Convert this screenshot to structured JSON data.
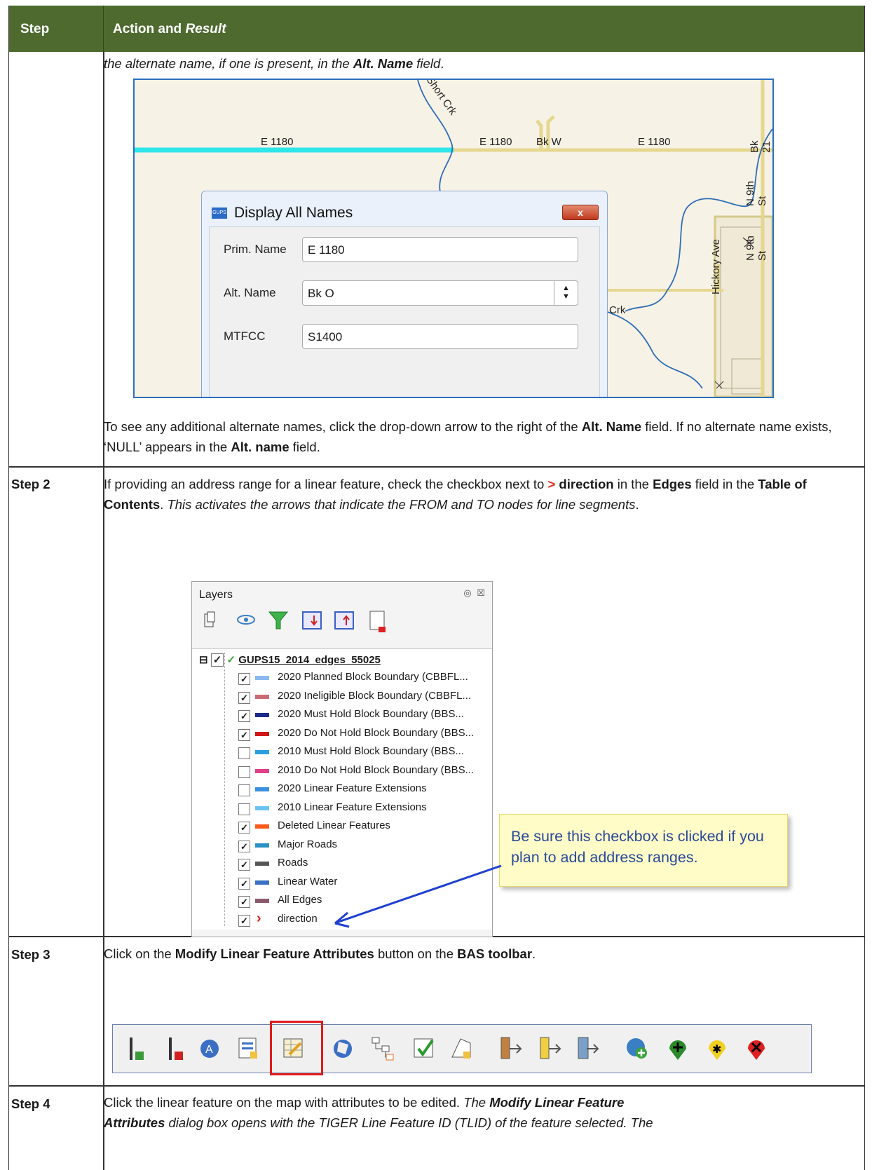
{
  "header": {
    "step_col": "Step",
    "action_col_a": "Action and ",
    "action_col_b": "Result"
  },
  "row1": {
    "text_a": "the alternate name, if one is present, in the ",
    "text_b": "Alt. Name",
    "text_c": " field",
    "text_d": ".",
    "map": {
      "labels": [
        "Short Crk",
        "E 1180",
        "E 1180",
        "Bk W",
        "E 1180",
        "Bk 21",
        "N 9th St",
        "N 9th St",
        "Hickory Ave",
        "Crk"
      ],
      "dialog": {
        "title": "Display All Names",
        "close": "x",
        "logo": "GUPS",
        "prim_label": "Prim. Name",
        "prim_value": "E 1180",
        "alt_label": "Alt. Name",
        "alt_value": "Bk O",
        "mtfcc_label": "MTFCC",
        "mtfcc_value": "S1400"
      }
    },
    "note_a": "To see any additional alternate names, click the drop-down arrow to the right of the ",
    "note_b": "Alt. Name",
    "note_c": " field. If no alternate name exists, ‘NULL’ appears in the ",
    "note_d": "Alt. name",
    "note_e": " field."
  },
  "step2": {
    "label": "Step 2",
    "t1": "If providing an address range for a linear feature, check the checkbox next to ",
    "t2": ">",
    "t3": " direction",
    "t4": " in the ",
    "t5": "Edges",
    "t6": " field in the ",
    "t7": "Table of Contents",
    "t8": ". ",
    "t9": "This activates the arrows that indicate the FROM and TO nodes for line segments",
    "t10": ".",
    "panel": {
      "title": "Layers",
      "root": "GUPS15_2014_edges_55025",
      "items": [
        {
          "label": "2020 Planned Block Boundary   (CBBFL...",
          "checked": "✓",
          "color": "#8bb8ef"
        },
        {
          "label": "2020 Ineligible Block Boundary  (CBBFL...",
          "checked": "✓",
          "color": "#c96a74"
        },
        {
          "label": "2020 Must Hold Block Boundary    (BBS...",
          "checked": "✓",
          "color": "#1a2a8c"
        },
        {
          "label": "2020 Do Not Hold Block Boundary (BBS...",
          "checked": "✓",
          "color": "#d01818"
        },
        {
          "label": "2010 Must Hold Block Boundary    (BBS...",
          "checked": "",
          "color": "#2a9fe0"
        },
        {
          "label": "2010 Do Not Hold Block Boundary (BBS...",
          "checked": "",
          "color": "#e0408a"
        },
        {
          "label": "2020 Linear Feature Extensions",
          "checked": "",
          "color": "#3a8fe0"
        },
        {
          "label": "2010 Linear Feature Extensions",
          "checked": "",
          "color": "#6bc4f0"
        },
        {
          "label": "Deleted Linear Features",
          "checked": "✓",
          "color": "#ff5a1a"
        },
        {
          "label": "Major Roads",
          "checked": "✓",
          "color": "#2a8fc4"
        },
        {
          "label": "Roads",
          "checked": "✓",
          "color": "#555555"
        },
        {
          "label": "Linear Water",
          "checked": "✓",
          "color": "#3a6fc4"
        },
        {
          "label": "All Edges",
          "checked": "✓",
          "color": "#8a5a6a"
        },
        {
          "label": "direction",
          "checked": "✓",
          "color": "#e01b1b"
        }
      ]
    },
    "callout": "Be sure this checkbox is clicked if you plan to add address ranges."
  },
  "step3": {
    "label": "Step 3",
    "t1": "Click on the ",
    "t2": "Modify Linear Feature Attributes",
    "t3": " button on the ",
    "t4": "BAS toolbar",
    "t5": "."
  },
  "step4": {
    "label": "Step 4",
    "t1": "Click the linear feature on the map with attributes to be edited. ",
    "t2": "The ",
    "t3": "Modify Linear Feature",
    "t4": "Attributes",
    "t5": " dialog box opens with the TIGER Line Feature ID (TLID) of the feature selected. The"
  }
}
